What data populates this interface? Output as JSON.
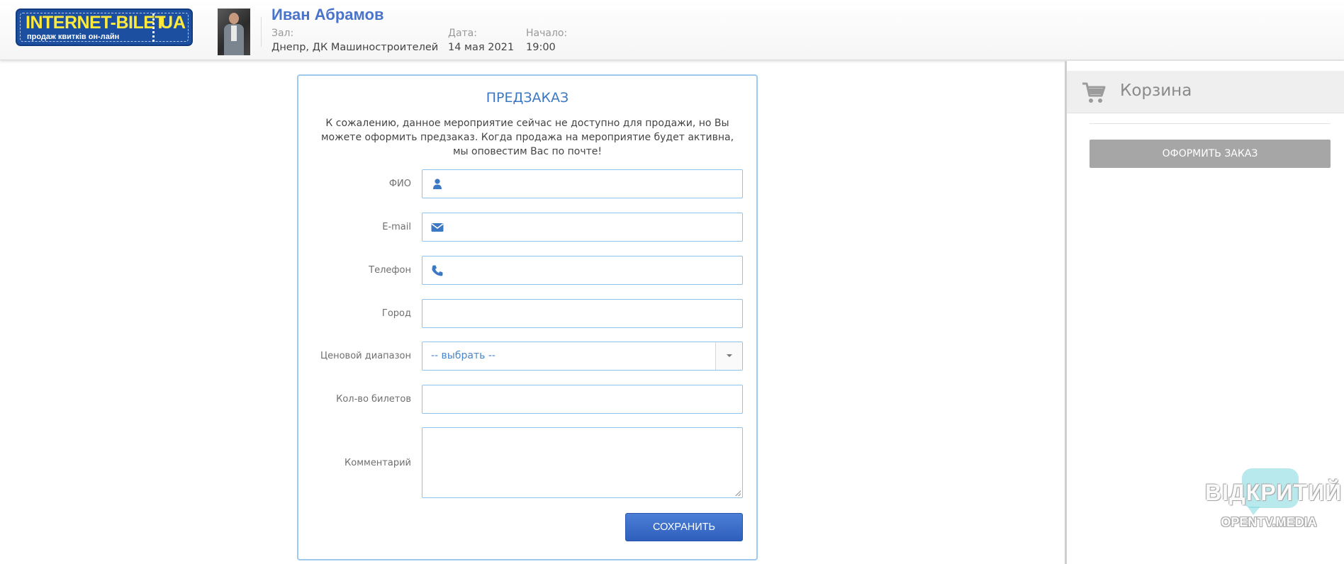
{
  "logo": {
    "main": "INTERNET-BILET",
    "ua": "UA",
    "tagline": "продаж квитків он-лайн"
  },
  "event": {
    "title": "Иван Абрамов",
    "hall_label": "Зал:",
    "hall_value": "Днепр, ДК Машиностроителей",
    "date_label": "Дата:",
    "date_value": "14 мая 2021",
    "start_label": "Начало:",
    "start_value": "19:00"
  },
  "form": {
    "title": "ПРЕДЗАКАЗ",
    "description": "К сожалению, данное мероприятие сейчас не доступно для продажи, но Вы можете оформить предзаказ. Когда продажа на мероприятие будет активна, мы оповестим Вас по почте!",
    "fields": {
      "name_label": "ФИО",
      "email_label": "E-mail",
      "phone_label": "Телефон",
      "city_label": "Город",
      "price_range_label": "Ценовой диапазон",
      "price_range_value": "-- выбрать --",
      "ticket_count_label": "Кол-во билетов",
      "comment_label": "Комментарий"
    },
    "save_label": "СОХРАНИТЬ"
  },
  "cart": {
    "title": "Корзина",
    "checkout_label": "ОФОРМИТЬ ЗАКАЗ"
  },
  "watermark": {
    "main": "ВІДКРИТИЙ",
    "sub": "OPENTV.MEDIA"
  },
  "colors": {
    "accent": "#4a74c9",
    "input_border": "#8ec3ee",
    "save_button": "#3566c6",
    "checkout_button": "#a6a6a6"
  },
  "icons": [
    "user-icon",
    "envelope-icon",
    "phone-icon",
    "chevron-down-icon",
    "cart-icon"
  ]
}
